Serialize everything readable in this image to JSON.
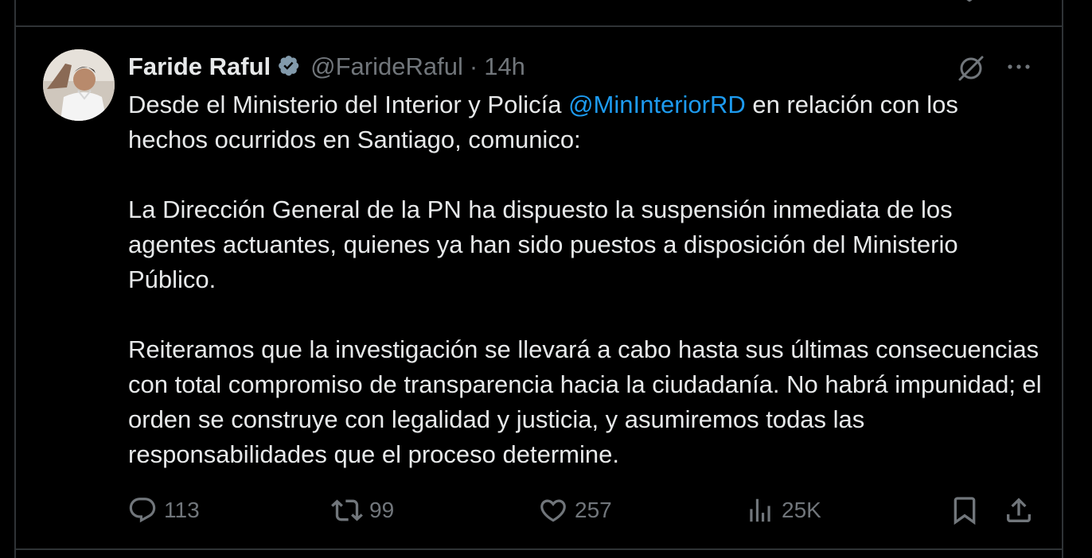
{
  "tweet": {
    "author": {
      "name": "Faride Raful",
      "handle": "@FarideRaful",
      "verified_icon": "verified-badge-icon"
    },
    "separator": "·",
    "time": "14h",
    "text": {
      "p1_before": "Desde el Ministerio del Interior y Policía ",
      "p1_mention": "@MinInteriorRD",
      "p1_after": " en relación con los hechos ocurridos en Santiago, comunico:",
      "p2": "La Dirección General de la PN ha dispuesto la suspensión inmediata de los agentes actuantes, quienes ya han sido puestos a disposición del Ministerio Público.",
      "p3": "Reiteramos que la investigación se llevará a cabo hasta sus últimas consecuencias con total compromiso de transparencia hacia la ciudadanía. No habrá impunidad; el orden se construye con legalidad y justicia, y asumiremos todas las responsabilidades que el proceso determine."
    },
    "actions": {
      "replies": "113",
      "reposts": "99",
      "likes": "257",
      "views": "25K"
    }
  },
  "colors": {
    "background": "#000000",
    "text_primary": "#e7e9ea",
    "text_secondary": "#71767b",
    "mention": "#1d9bf0",
    "verified_badge": "#829aab",
    "divider": "#2f3336"
  }
}
